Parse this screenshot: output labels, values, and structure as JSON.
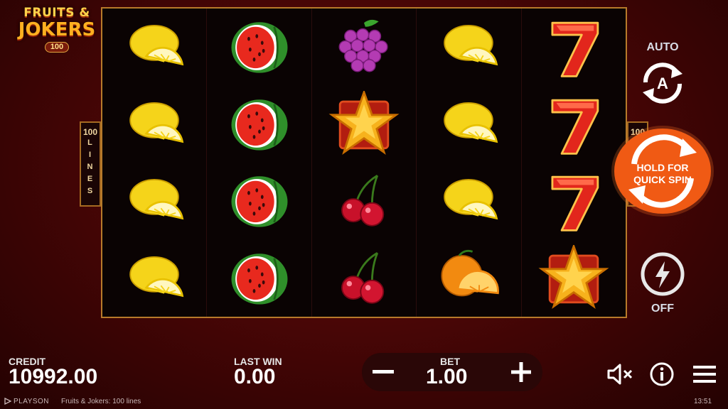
{
  "logo": {
    "line1": "FRUITS &",
    "line2": "JOKERS",
    "badge": "100"
  },
  "reels": [
    [
      "lemon",
      "lemon",
      "lemon",
      "lemon"
    ],
    [
      "watermelon",
      "watermelon",
      "watermelon",
      "watermelon"
    ],
    [
      "grapes",
      "star",
      "cherries",
      "cherries"
    ],
    [
      "lemon",
      "lemon",
      "lemon",
      "orange"
    ],
    [
      "seven",
      "seven",
      "seven",
      "star"
    ]
  ],
  "lines": {
    "count": "100",
    "word": "LINES"
  },
  "auto": {
    "label": "AUTO",
    "icon": "autoplay-icon"
  },
  "spin": {
    "label_line1": "HOLD FOR",
    "label_line2": "QUICK SPIN",
    "color": "#f05a14"
  },
  "turbo": {
    "label": "OFF",
    "icon": "lightning-icon"
  },
  "credit": {
    "label": "CREDIT",
    "value": "10992.00"
  },
  "last_win": {
    "label": "LAST WIN",
    "value": "0.00"
  },
  "bet": {
    "label": "BET",
    "value": "1.00",
    "minus": "−",
    "plus": "+"
  },
  "icons": {
    "sound": "sound-off-icon",
    "info": "info-icon",
    "menu": "menu-icon"
  },
  "footer": {
    "brand": "PLAYSON",
    "game": "Fruits & Jokers: 100 lines",
    "time": "13:51"
  }
}
